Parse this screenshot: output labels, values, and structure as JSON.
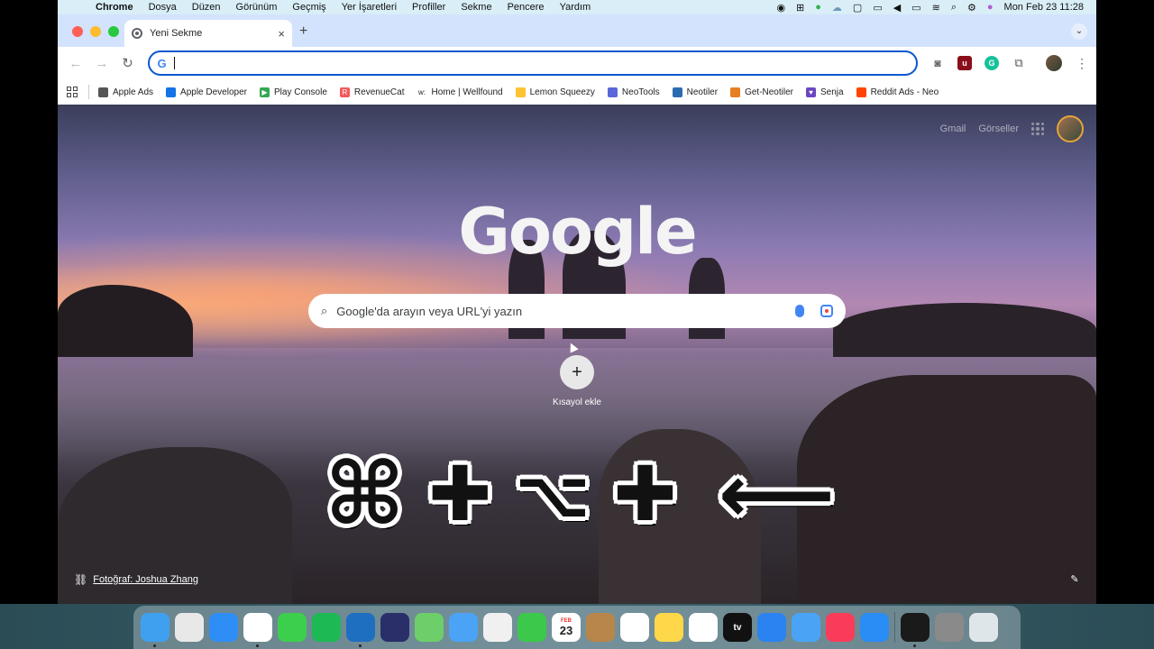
{
  "menubar": {
    "items": [
      "Chrome",
      "Dosya",
      "Düzen",
      "Görünüm",
      "Geçmiş",
      "Yer İşaretleri",
      "Profiller",
      "Sekme",
      "Pencere",
      "Yardım"
    ],
    "clock": "Mon Feb 23  11:28"
  },
  "tab": {
    "title": "Yeni Sekme",
    "close": "×",
    "new_tab": "+"
  },
  "omnibox": {
    "value": ""
  },
  "bookmarks": [
    {
      "label": "Apple Ads",
      "color": "#555555",
      "glyph": ""
    },
    {
      "label": "Apple Developer",
      "color": "#1473e6",
      "glyph": ""
    },
    {
      "label": "Play Console",
      "color": "#34a853",
      "glyph": "▶"
    },
    {
      "label": "RevenueCat",
      "color": "#f25a5a",
      "glyph": "R"
    },
    {
      "label": "Home | Wellfound",
      "color": "#ffffff",
      "glyph": "w:"
    },
    {
      "label": "Lemon Squeezy",
      "color": "#ffc233",
      "glyph": ""
    },
    {
      "label": "NeoTools",
      "color": "#5a67d8",
      "glyph": ""
    },
    {
      "label": "Neotiler",
      "color": "#2b6cb0",
      "glyph": ""
    },
    {
      "label": "Get-Neotiler",
      "color": "#e67e22",
      "glyph": ""
    },
    {
      "label": "Senja",
      "color": "#6b46c1",
      "glyph": "♥"
    },
    {
      "label": "Reddit Ads - Neo",
      "color": "#ff4500",
      "glyph": ""
    }
  ],
  "ntp": {
    "gmail": "Gmail",
    "images": "Görseller",
    "logo": "Google",
    "search_placeholder": "Google'da arayın veya URL'yi yazın",
    "shortcut_label": "Kısayol ekle",
    "photo_credit": "Fotoğraf: Joshua Zhang"
  },
  "overlay": {
    "cmd": "⌘",
    "plus": "✚",
    "opt": "⌥",
    "arrow": "⟵"
  },
  "dock": {
    "items": [
      {
        "name": "finder",
        "color": "#3fa0f0"
      },
      {
        "name": "launchpad",
        "color": "#e8e8e8"
      },
      {
        "name": "safari",
        "color": "#2f8ef5"
      },
      {
        "name": "chrome",
        "color": "#ffffff"
      },
      {
        "name": "messages",
        "color": "#3ccf4e"
      },
      {
        "name": "spotify",
        "color": "#1db954"
      },
      {
        "name": "vscode",
        "color": "#1f6fc1"
      },
      {
        "name": "arc",
        "color": "#2a2f6a"
      },
      {
        "name": "maps",
        "color": "#6ccf6a"
      },
      {
        "name": "mail",
        "color": "#4aa3f5"
      },
      {
        "name": "photos",
        "color": "#f0f0f0"
      },
      {
        "name": "facetime",
        "color": "#3cc84a"
      },
      {
        "name": "calendar",
        "color": "#ffffff"
      },
      {
        "name": "contacts",
        "color": "#b8864a"
      },
      {
        "name": "reminders",
        "color": "#ffffff"
      },
      {
        "name": "notes",
        "color": "#ffd84a"
      },
      {
        "name": "freeform",
        "color": "#ffffff"
      },
      {
        "name": "apple-tv",
        "color": "#111111"
      },
      {
        "name": "xcode",
        "color": "#2a83f0"
      },
      {
        "name": "mirror",
        "color": "#4aa3f5"
      },
      {
        "name": "music",
        "color": "#fa3c5a"
      },
      {
        "name": "app-store",
        "color": "#2a8cf5"
      },
      {
        "name": "terminal",
        "color": "#1a1a1a"
      },
      {
        "name": "system-settings",
        "color": "#8a8a8a"
      }
    ],
    "calendar_month": "FEB",
    "calendar_day": "23",
    "tv_label": "tv"
  }
}
